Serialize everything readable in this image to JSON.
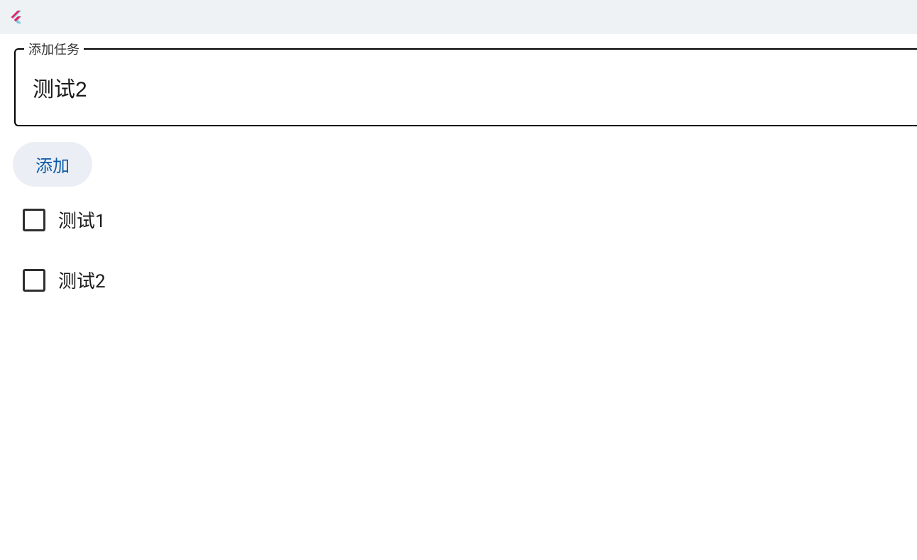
{
  "header": {
    "logo_colors": {
      "primary": "#e91e63",
      "secondary": "#7ec8e3"
    }
  },
  "form": {
    "label": "添加任务",
    "input_value": "测试2",
    "add_button_label": "添加"
  },
  "tasks": [
    {
      "label": "测试1",
      "checked": false
    },
    {
      "label": "测试2",
      "checked": false
    }
  ]
}
